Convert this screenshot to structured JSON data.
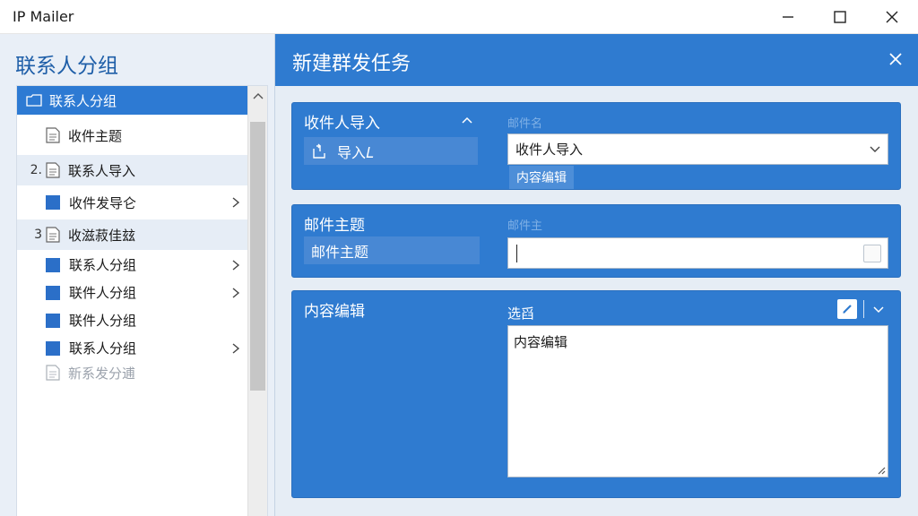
{
  "window": {
    "title": "IP Mailer",
    "controls": {
      "minimize": "minimize-icon",
      "maximize": "maximize-icon",
      "close": "close-icon"
    }
  },
  "sidebar": {
    "title": "联系人分组",
    "items": [
      {
        "num": "",
        "label": "联系人分组",
        "icon": "folder-icon",
        "selected": true
      },
      {
        "num": "",
        "label": "收件主题",
        "icon": "document-icon"
      },
      {
        "num": "2.",
        "label": "联系人导入",
        "icon": "document-icon"
      },
      {
        "num": "",
        "label": "收件发导仑",
        "icon": "square-icon",
        "chevron": true
      },
      {
        "num": "3",
        "label": "收滋菽佳玆",
        "icon": "document-icon"
      },
      {
        "num": "",
        "label": "联系人分组",
        "icon": "square-icon",
        "chevron": true
      },
      {
        "num": "",
        "label": "联件人分组",
        "icon": "square-icon",
        "chevron": true
      },
      {
        "num": "",
        "label": "联件人分组",
        "icon": "square-icon"
      },
      {
        "num": "",
        "label": "联系人分组",
        "icon": "square-icon",
        "chevron": true
      },
      {
        "num": "",
        "label": "新系发分逋",
        "icon": "document-icon",
        "disabled": true
      }
    ]
  },
  "main": {
    "title": "新建群发任务",
    "sections": {
      "recipient_import": {
        "title": "收件人导入",
        "button": "导入𝐿",
        "field_label": "邮件名",
        "select_value": "收件人导入",
        "tag": "内容编辑"
      },
      "subject": {
        "title": "邮件主题",
        "button": "邮件主题",
        "field_label": "邮件主",
        "input_value": ""
      },
      "content": {
        "title": "内容编辑",
        "field_label": "选舀",
        "textarea_value": "内容编辑"
      }
    }
  },
  "colors": {
    "accent": "#2f7bd0",
    "selected": "#2d7ad3",
    "sidebar_title": "#1e5ea8",
    "square_icon": "#2b6fc8"
  }
}
